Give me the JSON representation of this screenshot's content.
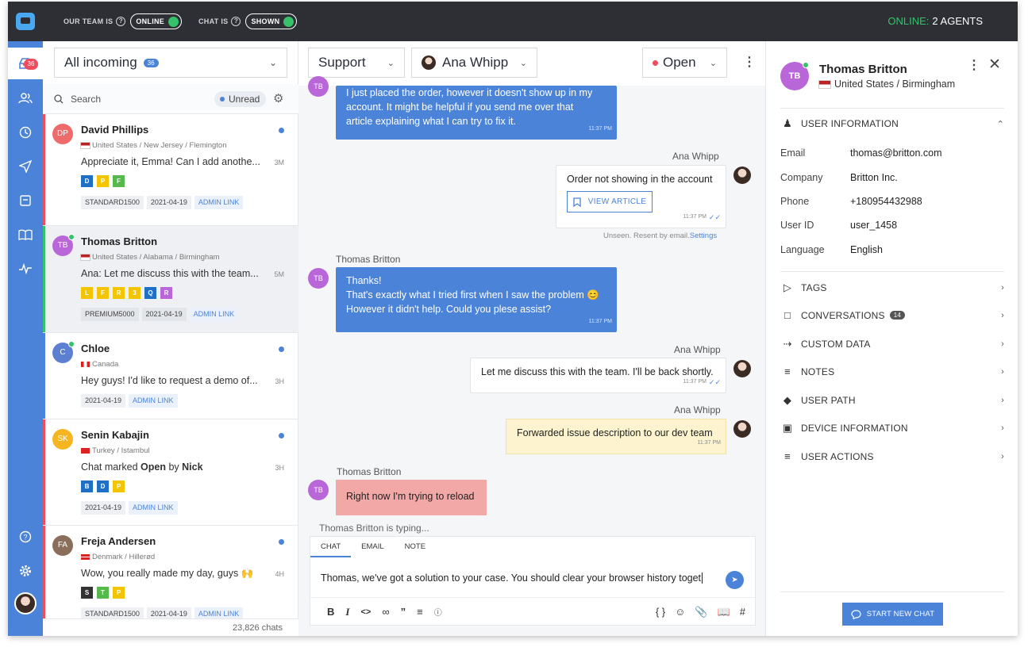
{
  "topbar": {
    "team_label": "OUR TEAM IS",
    "team_status": "ONLINE",
    "chat_label": "CHAT IS",
    "chat_status": "SHOWN",
    "online_label": "ONLINE:",
    "online_value": "2 AGENTS"
  },
  "nav": {
    "inbox_badge": "36"
  },
  "list": {
    "filter_label": "All incoming",
    "filter_count": "36",
    "search_placeholder": "Search",
    "unread_label": "Unread",
    "footer": "23,826 chats",
    "conversations": [
      {
        "initials": "DP",
        "name": "David Phillips",
        "location": "United States / New Jersey / Flemington",
        "preview": "Appreciate it, Emma! Can I add anothe...",
        "time": "3M",
        "tags": [
          "D",
          "P",
          "F"
        ],
        "chips": [
          "STANDARD1500",
          "2021-04-19"
        ],
        "link": "ADMIN LINK"
      },
      {
        "initials": "TB",
        "name": "Thomas Britton",
        "location": "United States / Alabama / Birmingham",
        "preview": "Ana: Let me discuss this with the team...",
        "time": "5M",
        "tags": [
          "L",
          "F",
          "R",
          "3",
          "Q",
          "R"
        ],
        "chips": [
          "PREMIUM5000",
          "2021-04-19"
        ],
        "link": "ADMIN LINK"
      },
      {
        "initials": "C",
        "name": "Chloe",
        "location": "Canada",
        "preview": "Hey guys! I'd like to request a demo of...",
        "time": "3H",
        "tags": [],
        "chips": [
          "2021-04-19"
        ],
        "link": "ADMIN LINK"
      },
      {
        "initials": "SK",
        "name": "Senin Kabajin",
        "location": "Turkey / Istambul",
        "preview_pre": "Chat marked ",
        "preview_b1": "Open",
        "preview_mid": " by ",
        "preview_b2": "Nick",
        "time": "3H",
        "tags": [
          "B",
          "D",
          "P"
        ],
        "chips": [
          "2021-04-19"
        ],
        "link": "ADMIN LINK"
      },
      {
        "initials": "FA",
        "name": "Freja Andersen",
        "location": "Denmark / Hillerød",
        "preview": "Wow, you really made my day, guys 🙌",
        "time": "4H",
        "tags": [
          "S",
          "T",
          "P"
        ],
        "chips": [
          "STANDARD1500",
          "2021-04-19"
        ],
        "link": "ADMIN LINK"
      }
    ]
  },
  "chat": {
    "team": "Support",
    "agent": "Ana Whipp",
    "status": "Open",
    "messages": {
      "m1_line1": "I just placed the order, however it doesn't show up in my",
      "m1_line2": "account. It might be helpful if you send me over that",
      "m1_line3": "article explaining what I can try to fix it.",
      "m1_time": "11:37 PM",
      "m2_sender": "Ana Whipp",
      "m2_text": "Order not showing in the account",
      "m2_button": "VIEW ARTICLE",
      "m2_time": "11:37 PM",
      "m2_note": "Unseen. Resent by email.",
      "m2_note_link": "Settings",
      "m3_sender": "Thomas Britton",
      "m3_line1": "Thanks!",
      "m3_line2": "That's exactly what I tried first when I saw the problem 😊",
      "m3_line3": "However it didn't help. Could you plese assist?",
      "m3_time": "11:37 PM",
      "m4_sender": "Ana Whipp",
      "m4_text": "Let me discuss this with the team. I'll be back shortly.",
      "m4_time": "11:37 PM",
      "m5_sender": "Ana Whipp",
      "m5_text": "Forwarded issue description to our dev team",
      "m5_time": "11:37 PM",
      "m6_sender": "Thomas Britton",
      "m6_text": "Right now I'm trying to reload",
      "avatar_initials": "TB"
    },
    "typing": "Thomas Britton is typing...",
    "composer": {
      "tab_chat": "CHAT",
      "tab_email": "EMAIL",
      "tab_note": "NOTE",
      "text": "Thomas, we've got a solution to your case. You should clear your browser history toget"
    }
  },
  "profile": {
    "initials": "TB",
    "name": "Thomas Britton",
    "location": "United States / Birmingham",
    "user_info_title": "USER INFORMATION",
    "fields": [
      {
        "key": "Email",
        "value": "thomas@britton.com"
      },
      {
        "key": "Company",
        "value": "Britton Inc."
      },
      {
        "key": "Phone",
        "value": "+180954432988"
      },
      {
        "key": "User ID",
        "value": "user_1458"
      },
      {
        "key": "Language",
        "value": "English"
      }
    ],
    "sections": {
      "tags": "TAGS",
      "conversations": "CONVERSATIONS",
      "conversations_count": "14",
      "custom_data": "CUSTOM DATA",
      "notes": "NOTES",
      "user_path": "USER PATH",
      "device": "DEVICE INFORMATION",
      "actions": "USER ACTIONS"
    },
    "start_button": "START NEW CHAT"
  },
  "colors": {
    "accent": "#4b83d9",
    "online": "#35c26b",
    "topbar": "#2d2f34",
    "danger": "#ee4d5f"
  }
}
